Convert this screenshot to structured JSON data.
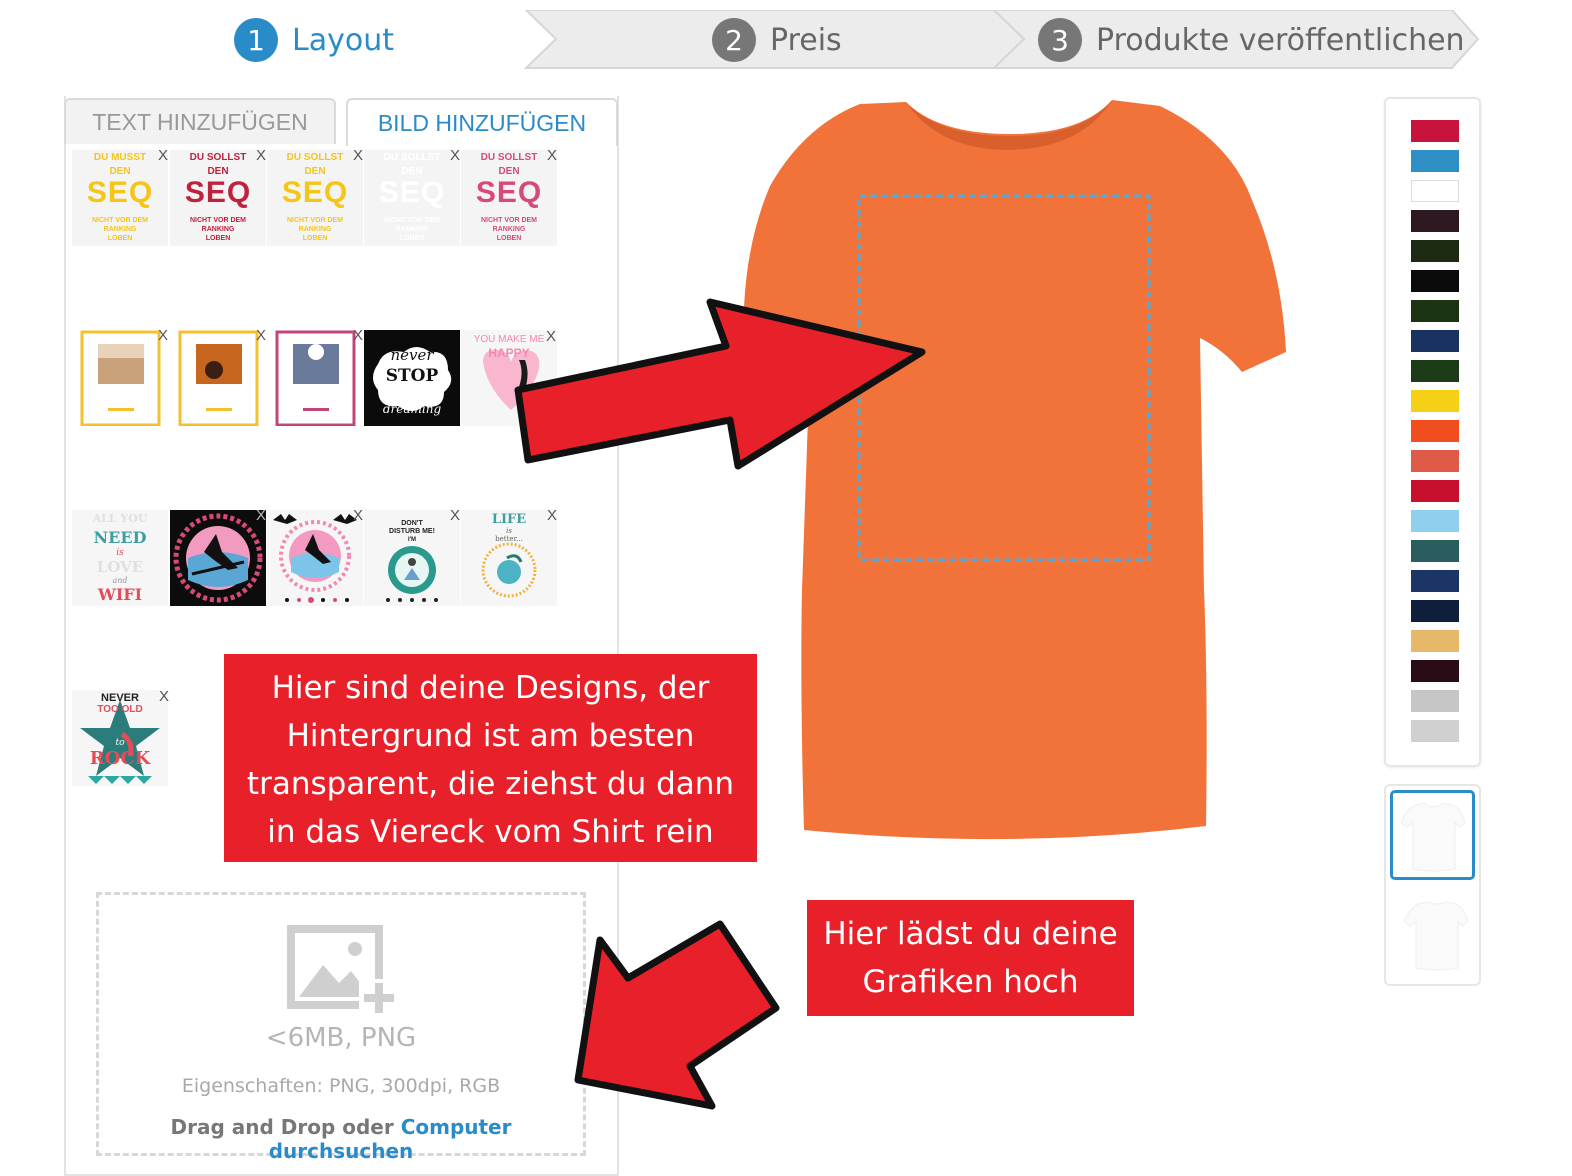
{
  "stepper": {
    "steps": [
      {
        "number": "1",
        "label": "Layout",
        "active": true
      },
      {
        "number": "2",
        "label": "Preis",
        "active": false
      },
      {
        "number": "3",
        "label": "Produkte veröffentlichen",
        "active": false
      }
    ]
  },
  "tabs": {
    "text_label": "TEXT HINZUFÜGEN",
    "image_label": "BILD HINZUFÜGEN"
  },
  "designs": {
    "remove_label": "X",
    "seq": [
      {
        "top": "DU MUSST",
        "mid": "DEN",
        "big": "SEQ",
        "foot1": "NICHT VOR DEM",
        "foot2": "RANKING",
        "foot3": "LOBEN",
        "color": "#f5c518"
      },
      {
        "top": "DU SOLLST",
        "mid": "DEN",
        "big": "SEQ",
        "foot1": "NICHT VOR DEM",
        "foot2": "RANKING",
        "foot3": "LOBEN",
        "color": "#c0213d"
      },
      {
        "top": "DU SOLLST",
        "mid": "DEN",
        "big": "SEQ",
        "foot1": "NICHT VOR DEM",
        "foot2": "RANKING",
        "foot3": "LOBEN",
        "color": "#f5c518"
      },
      {
        "top": "DU SOLLST",
        "mid": "DEN",
        "big": "SEQ",
        "foot1": "NICHT VOR DEM",
        "foot2": "RANKING",
        "foot3": "LOBEN",
        "color": "#ffffff"
      },
      {
        "top": "DU SOLLST",
        "mid": "DEN",
        "big": "SEQ",
        "foot1": "NICHT VOR DEM",
        "foot2": "RANKING",
        "foot3": "LOBEN",
        "color": "#d64a78"
      }
    ],
    "never_stop": {
      "line1": "never",
      "line2": "STOP",
      "line3": "dreaming"
    },
    "you_make_me": {
      "line1": "YOU MAKE ME",
      "line2": "HAPPY"
    },
    "wifi": {
      "line1": "ALL YOU",
      "line2": "NEED",
      "line3": "is",
      "line4": "LOVE",
      "line5": "and",
      "line6": "WIFI"
    },
    "dont_disturb": {
      "line1": "DON'T",
      "line2": "DISTURB ME!",
      "line3": "I'M"
    },
    "life_beach": {
      "line1": "LIFE",
      "line2": "is",
      "line3": "better..."
    },
    "never_rock": {
      "line1": "NEVER",
      "line2": "TOO OLD",
      "line3": "to",
      "line4": "ROCK"
    }
  },
  "upload": {
    "limit": "<6MB, PNG",
    "properties": "Eigenschaften: PNG, 300dpi, RGB",
    "drag_text": "Drag and Drop oder ",
    "browse_link": "Computer durchsuchen"
  },
  "shirt": {
    "color": "#f2733a",
    "print_area_border": "#5aa7d6"
  },
  "palette": {
    "colors": [
      "#c8143c",
      "#2d8fc4",
      "#ffffff",
      "#2e1822",
      "#1c2a14",
      "#0a0a0a",
      "#1c3312",
      "#1a3260",
      "#1b3a16",
      "#f5d016",
      "#f04e1e",
      "#e05a48",
      "#c8102e",
      "#8fd0ef",
      "#2a5e5e",
      "#1a3566",
      "#0e1f3b",
      "#e6b96a",
      "#2a0c16",
      "#c6c6c6",
      "#d0d0d0"
    ]
  },
  "callouts": {
    "designs": [
      "Hier sind deine Designs, der",
      "Hintergrund ist am besten",
      "transparent, die ziehst du dann",
      "in das Viereck vom Shirt rein"
    ],
    "upload": [
      "Hier lädst du deine",
      "Grafiken hoch"
    ]
  }
}
